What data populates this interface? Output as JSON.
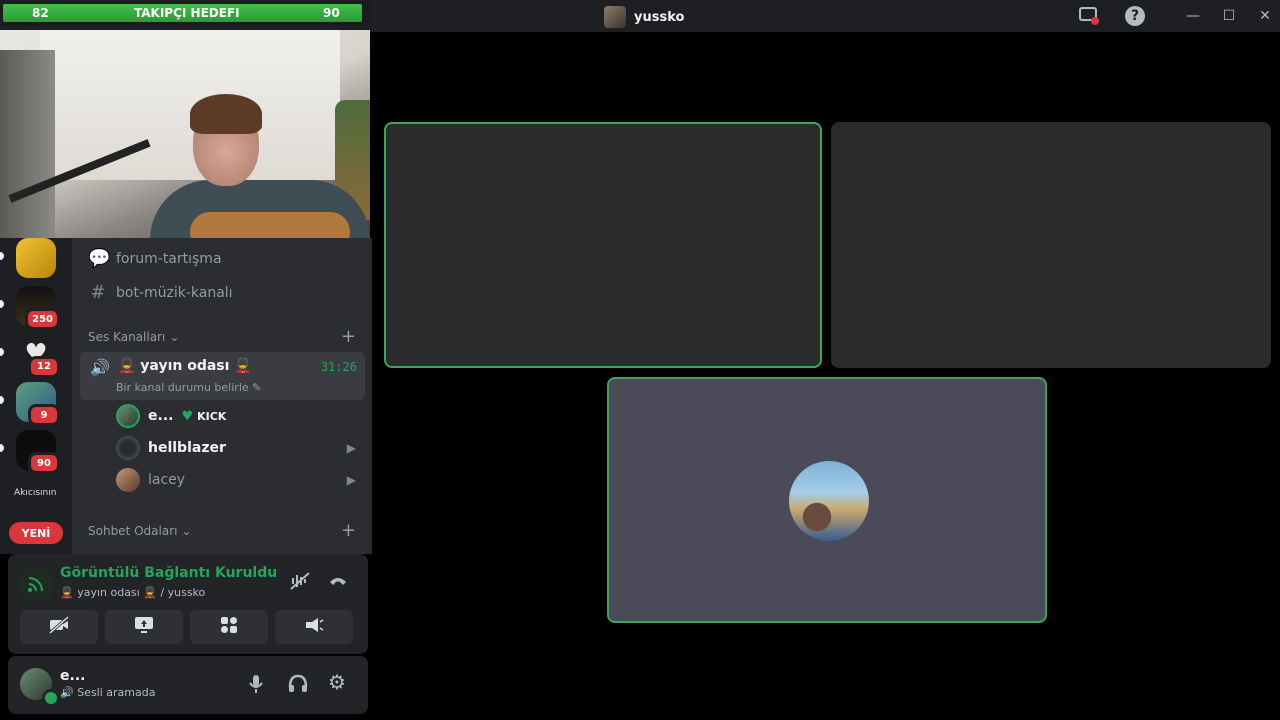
{
  "titlebar": {
    "goal_min": "82",
    "goal_label": "TAKIPÇI HEDEFI",
    "goal_max": "90",
    "goal_progress": 0.98,
    "title": "yussko"
  },
  "servers": [
    {
      "badge": ""
    },
    {
      "badge": "250"
    },
    {
      "badge": "12"
    },
    {
      "badge": "9"
    },
    {
      "badge": "90"
    }
  ],
  "server_text": "Akıcısının",
  "new_label": "YENİ",
  "channels": {
    "forum": "forum-tartışma",
    "bot": "bot-müzik-kanalı",
    "voice_category": "Ses Kanalları",
    "chat_category": "Sohbet Odaları"
  },
  "voice_channel": {
    "name": "💂 yayın odası 💂",
    "time": "31:26",
    "status": "Bir kanal durumu belirle"
  },
  "voice_users": [
    {
      "name": "e...",
      "tag": "KICK"
    },
    {
      "name": "hellblazer"
    },
    {
      "name": "lacey"
    }
  ],
  "connection": {
    "title": "Görüntülü Bağlantı Kuruldu",
    "subtitle": "💂 yayın odası 💂 / yussko"
  },
  "user_panel": {
    "name": "e...",
    "status": "Sesli aramada"
  },
  "colors": {
    "accent_green": "#23a55a",
    "danger_red": "#da373c",
    "speaking_border": "#3ba55d"
  },
  "icons": [
    "screen-share-icon",
    "help-icon",
    "minimize-icon",
    "maximize-icon",
    "close-icon",
    "thread-icon",
    "hash-icon",
    "speaker-icon",
    "camera-icon",
    "signal-icon",
    "noise-suppression-icon",
    "hangup-icon",
    "camera-off-icon",
    "share-screen-icon",
    "activity-icon",
    "soundboard-icon",
    "microphone-icon",
    "headphones-icon",
    "gear-icon"
  ]
}
